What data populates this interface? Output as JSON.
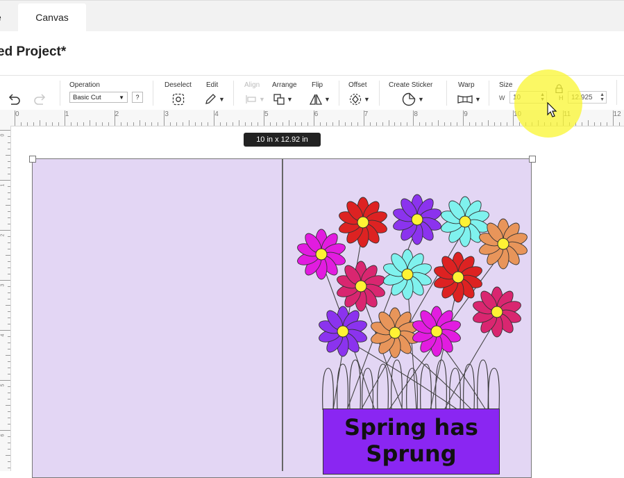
{
  "tabs": {
    "home_partial": "e",
    "canvas": "Canvas"
  },
  "project_title": "ed Project*",
  "toolbar": {
    "operation": {
      "label": "Operation",
      "value": "Basic Cut",
      "help": "?"
    },
    "deselect": {
      "label": "Deselect"
    },
    "edit": {
      "label": "Edit"
    },
    "align": {
      "label": "Align"
    },
    "arrange": {
      "label": "Arrange"
    },
    "flip": {
      "label": "Flip"
    },
    "offset": {
      "label": "Offset"
    },
    "create_sticker": {
      "label": "Create Sticker"
    },
    "warp": {
      "label": "Warp"
    },
    "size": {
      "label": "Size",
      "w_letter": "W",
      "w_value": "10",
      "h_letter": "H",
      "h_value": "12.925"
    }
  },
  "ruler": {
    "top_labels": [
      "0",
      "1",
      "2",
      "3",
      "4",
      "5",
      "6",
      "7",
      "8",
      "9",
      "10",
      "11",
      "12"
    ],
    "left_labels": [
      "0",
      "1",
      "2",
      "3",
      "4",
      "5",
      "6"
    ]
  },
  "selection_tooltip": "10  in x 12.92  in",
  "card": {
    "label_text_line1": "Spring has",
    "label_text_line2": "Sprung"
  },
  "colors": {
    "card_bg": "#e3d6f4",
    "label_bg": "#8a26f2",
    "cursor_highlight": "#faf528"
  }
}
